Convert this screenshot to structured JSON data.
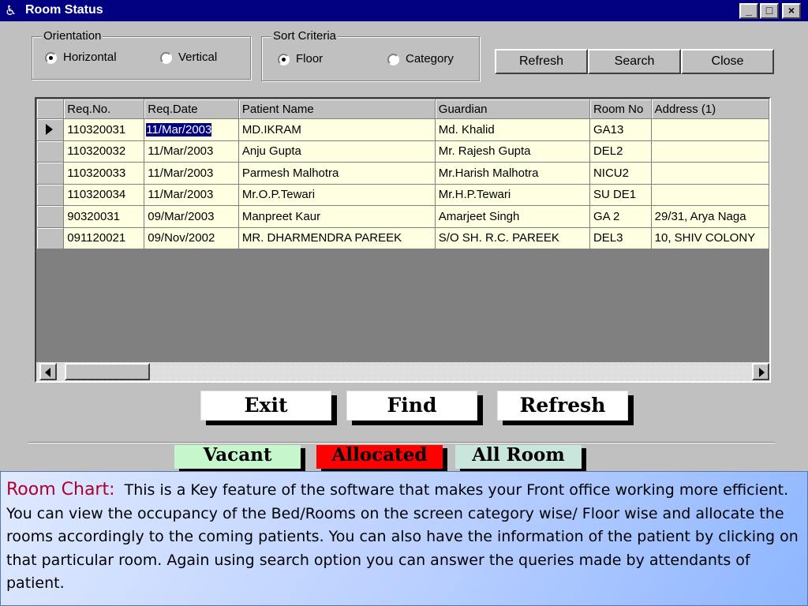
{
  "window": {
    "title": "Room Status",
    "icon": "wheelchair-icon",
    "min_label": "_",
    "max_label": "□",
    "close_label": "×"
  },
  "orientation": {
    "legend": "Orientation",
    "options": [
      "Horizontal",
      "Vertical"
    ],
    "selected": "Horizontal"
  },
  "sort": {
    "legend": "Sort Criteria",
    "options": [
      "Floor",
      "Category"
    ],
    "selected": "Floor"
  },
  "toolbar": {
    "refresh": "Refresh",
    "search": "Search",
    "close": "Close"
  },
  "grid": {
    "columns": [
      "Req.No.",
      "Req.Date",
      "Patient Name",
      "Guardian",
      "Room No",
      "Address (1)"
    ],
    "rows": [
      [
        "110320031",
        "11/Mar/2003",
        "MD.IKRAM",
        "Md. Khalid",
        "GA13",
        ""
      ],
      [
        "110320032",
        "11/Mar/2003",
        "Anju Gupta",
        "Mr. Rajesh Gupta",
        "DEL2",
        ""
      ],
      [
        "110320033",
        "11/Mar/2003",
        "Parmesh Malhotra",
        "Mr.Harish Malhotra",
        "NICU2",
        ""
      ],
      [
        "110320034",
        "11/Mar/2003",
        "Mr.O.P.Tewari",
        "Mr.H.P.Tewari",
        "SU DE1",
        ""
      ],
      [
        "90320031",
        "09/Mar/2003",
        "Manpreet Kaur",
        "Amarjeet Singh",
        "GA 2",
        "29/31, Arya Naga"
      ],
      [
        "091120021",
        "09/Nov/2002",
        "MR. DHARMENDRA PAREEK",
        "S/O SH. R.C. PAREEK",
        "DEL3",
        "10, SHIV COLONY"
      ]
    ],
    "current_row": 0
  },
  "actions": {
    "exit": "Exit",
    "find": "Find",
    "refresh": "Refresh"
  },
  "tabs": [
    {
      "label": "Vacant",
      "color": "#c6f7cc"
    },
    {
      "label": "Allocated",
      "color": "#ff0000"
    },
    {
      "label": "All Room",
      "color": "#c9e6dd"
    }
  ],
  "caption": {
    "lead": "Room Chart:",
    "body": "This  is  a  Key feature  of  the software that makes your Front office working more efficient. You can view the occupancy of the Bed/Rooms on the screen category wise/ Floor wise and allocate the rooms accordingly to the coming patients. You can also have the  information of the patient by clicking on that particular room. Again using search option you can answer the queries made by attendants of patient."
  }
}
